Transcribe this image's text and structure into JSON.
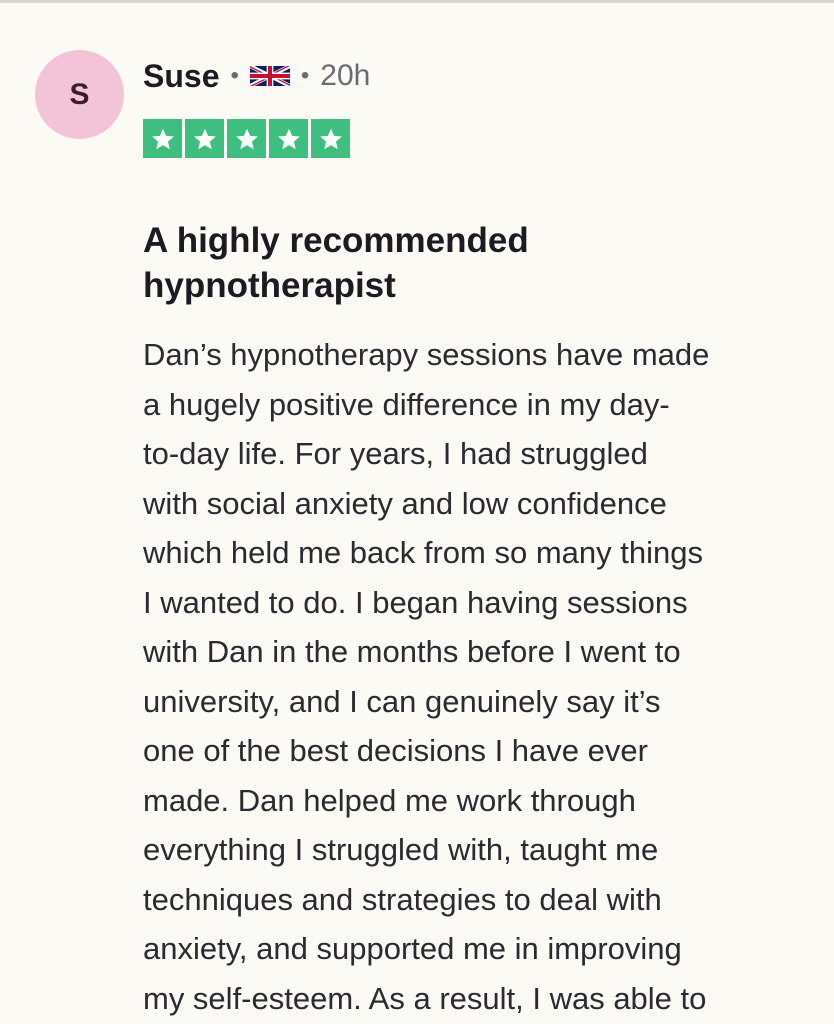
{
  "review": {
    "avatar_initial": "S",
    "reviewer_name": "Suse",
    "country_icon": "uk-flag-icon",
    "separator": "•",
    "posted": "20h",
    "rating": 5,
    "rating_color": "#3fbf7f",
    "title": "A highly recommended\nhypnotherapist",
    "body": "Dan’s hypnotherapy sessions have made\na hugely positive difference in my day-\nto-day life. For years, I had struggled\nwith social anxiety and low confidence\nwhich held me back from so many things\nI wanted to do. I began having sessions\nwith Dan in the months before I went to\nuniversity, and I can genuinely say it’s\none of the best decisions I have ever\nmade. Dan helped me work through\neverything I struggled with, taught me\ntechniques and strategies to deal with\nanxiety, and supported me in improving\nmy self-esteem. As a result, I was able to"
  }
}
